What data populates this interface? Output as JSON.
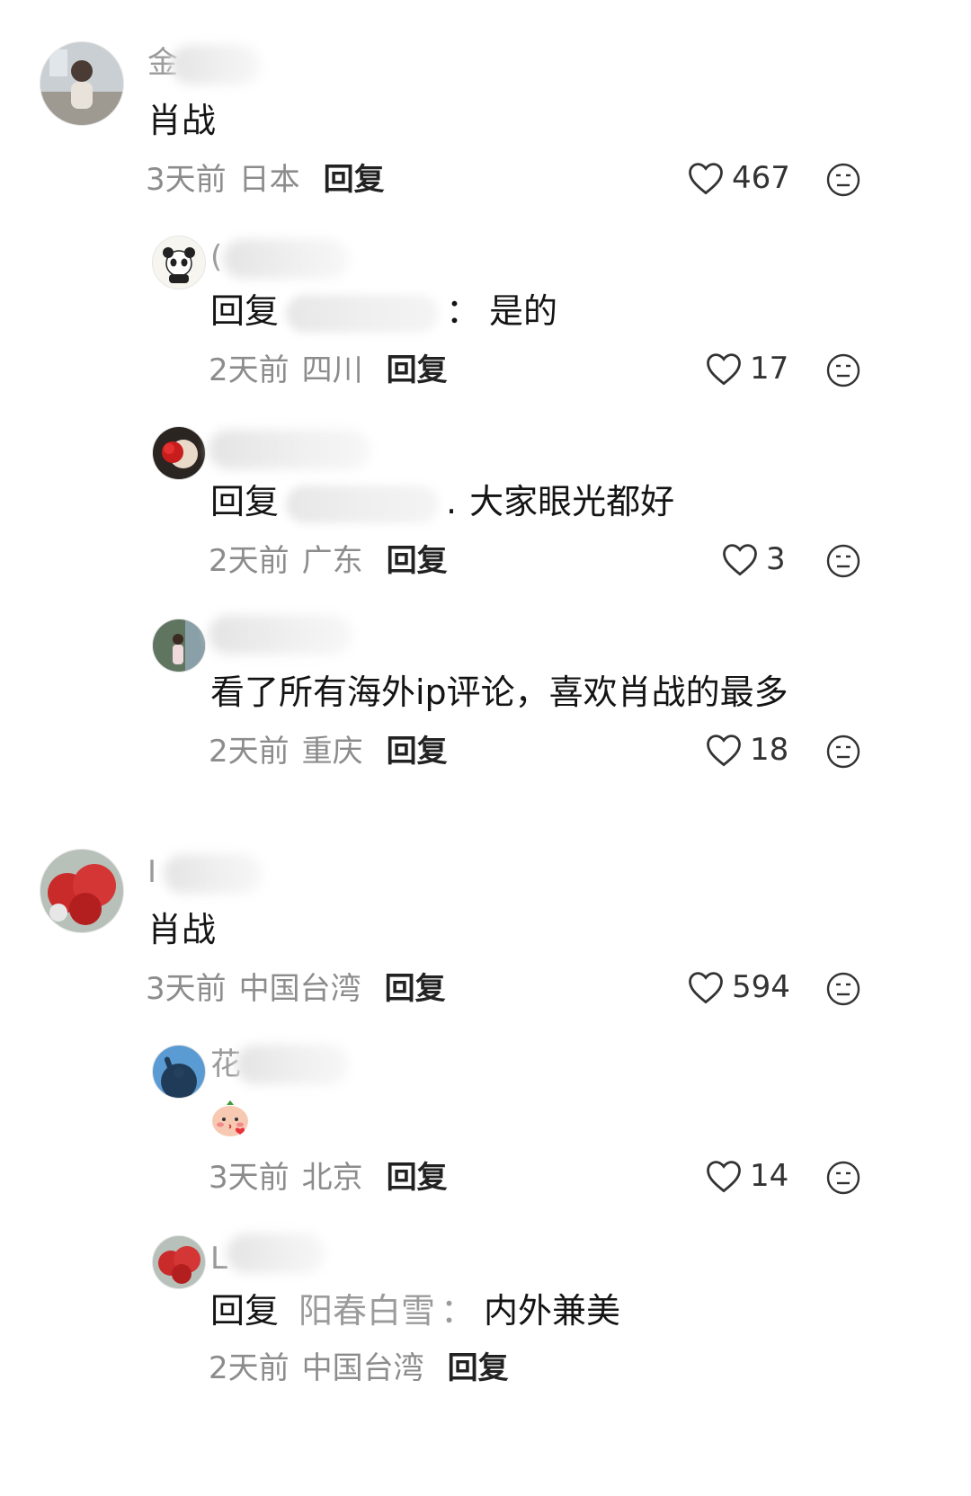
{
  "comments": [
    {
      "text": "肖战",
      "time": "3天前",
      "location": "日本",
      "reply_label": "回复",
      "likes": "467",
      "name_initial": "金"
    },
    {
      "reply_prefix": "回复",
      "reply_sep": "：",
      "text": "是的",
      "time": "2天前",
      "location": "四川",
      "reply_label": "回复",
      "likes": "17",
      "name_initial": "("
    },
    {
      "reply_prefix": "回复",
      "reply_sep": ".",
      "text": "大家眼光都好",
      "time": "2天前",
      "location": "广东",
      "reply_label": "回复",
      "likes": "3"
    },
    {
      "text": "看了所有海外ip评论，喜欢肖战的最多",
      "time": "2天前",
      "location": "重庆",
      "reply_label": "回复",
      "likes": "18"
    },
    {
      "text": "肖战",
      "time": "3天前",
      "location": "中国台湾",
      "reply_label": "回复",
      "likes": "594",
      "name_initial": "I"
    },
    {
      "emoji": "kiss-emoji",
      "time": "3天前",
      "location": "北京",
      "reply_label": "回复",
      "likes": "14",
      "name_initial": "花"
    },
    {
      "reply_prefix": "回复",
      "reply_target": "阳春白雪",
      "reply_sep": "：",
      "text": "内外兼美",
      "time": "2天前",
      "location": "中国台湾",
      "reply_label": "回复",
      "name_initial": "L"
    }
  ],
  "icons": {
    "like": "heart-outline-icon",
    "dislike": "neutral-face-icon"
  }
}
